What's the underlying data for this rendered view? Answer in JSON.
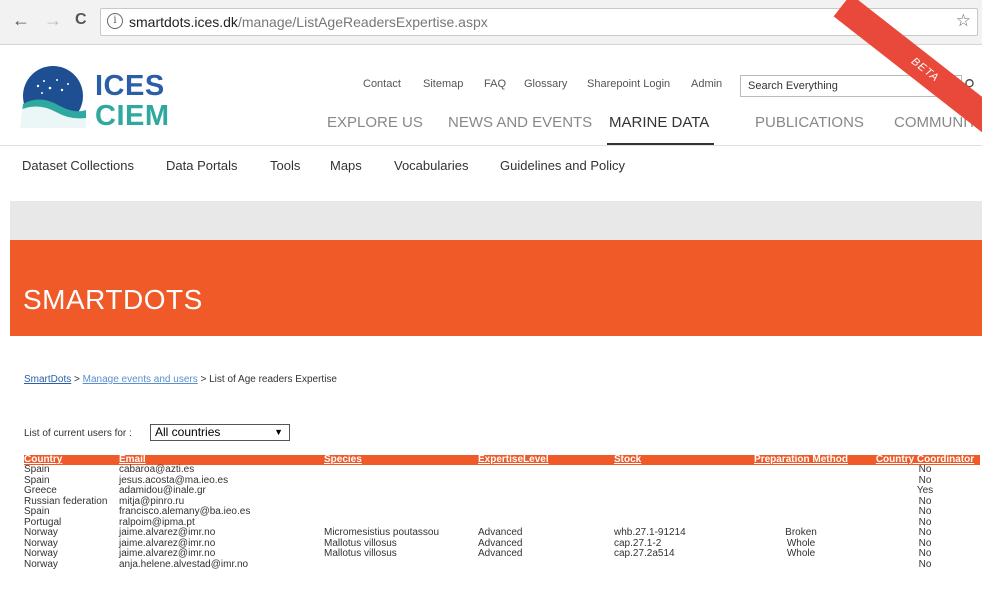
{
  "browser": {
    "back": "←",
    "forward": "→",
    "reload": "C",
    "info": "i",
    "url_host": "smartdots.ices.dk",
    "url_path": "/manage/ListAgeReadersExpertise.aspx",
    "star": "☆"
  },
  "site": {
    "logo_line1": "ICES",
    "logo_line2": "CIEM",
    "top_links": [
      "Contact",
      "Sitemap",
      "FAQ",
      "Glossary",
      "Sharepoint Login",
      "Admin"
    ],
    "search_placeholder": "Search Everything",
    "search_icon": "⚲",
    "beta": "BETA",
    "main_nav": [
      "EXPLORE US",
      "NEWS AND EVENTS",
      "MARINE DATA",
      "PUBLICATIONS",
      "COMMUNITY"
    ],
    "main_nav_active": "MARINE DATA",
    "sub_nav": [
      "Dataset Collections",
      "Data Portals",
      "Tools",
      "Maps",
      "Vocabularies",
      "Guidelines and Policy"
    ]
  },
  "hero": {
    "title": "SMARTDOTS"
  },
  "breadcrumb": {
    "item1": "SmartDots",
    "sep": ">",
    "item2": "Manage events and users",
    "current": "List of Age readers Expertise"
  },
  "filter": {
    "label": "List of current users for :",
    "selected": "All countries",
    "caret": "▼"
  },
  "table": {
    "headers": [
      "Country",
      "Email",
      "Species",
      "ExpertiseLevel",
      "Stock",
      "Preparation Method",
      "Country Coordinator"
    ],
    "rows": [
      [
        "Spain",
        "cabaroa@azti.es",
        "",
        "",
        "",
        "",
        "No"
      ],
      [
        "Spain",
        "jesus.acosta@ma.ieo.es",
        "",
        "",
        "",
        "",
        "No"
      ],
      [
        "Greece",
        "adamidou@inale.gr",
        "",
        "",
        "",
        "",
        "Yes"
      ],
      [
        "Russian federation",
        "mitja@pinro.ru",
        "",
        "",
        "",
        "",
        "No"
      ],
      [
        "Spain",
        "francisco.alemany@ba.ieo.es",
        "",
        "",
        "",
        "",
        "No"
      ],
      [
        "Portugal",
        "ralpoim@ipma.pt",
        "",
        "",
        "",
        "",
        "No"
      ],
      [
        "Norway",
        "jaime.alvarez@imr.no",
        "Micromesistius poutassou",
        "Advanced",
        "whb.27.1-91214",
        "Broken",
        "No"
      ],
      [
        "Norway",
        "jaime.alvarez@imr.no",
        "Mallotus villosus",
        "Advanced",
        "cap.27.1-2",
        "Whole",
        "No"
      ],
      [
        "Norway",
        "jaime.alvarez@imr.no",
        "Mallotus villosus",
        "Advanced",
        "cap.27.2a514",
        "Whole",
        "No"
      ],
      [
        "Norway",
        "anja.helene.alvestad@imr.no",
        "",
        "",
        "",
        "",
        "No"
      ]
    ]
  },
  "colors": {
    "accent": "#ef5a28",
    "brand_blue": "#2a5ea8",
    "brand_teal": "#2fa8a0",
    "beta_ribbon": "#e8493a"
  }
}
